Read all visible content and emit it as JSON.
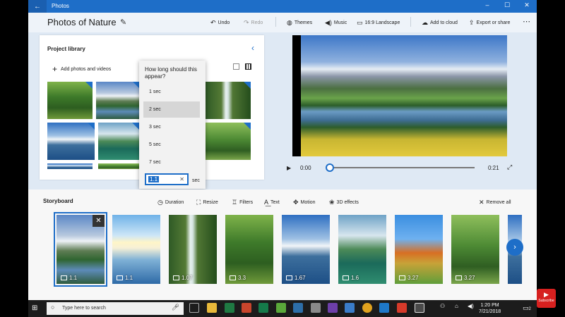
{
  "window": {
    "app_name": "Photos",
    "back_icon": "←",
    "minimize": "–",
    "maximize": "☐",
    "close": "✕"
  },
  "header": {
    "project_title": "Photos of Nature",
    "undo": "Undo",
    "redo": "Redo",
    "themes": "Themes",
    "music": "Music",
    "aspect": "16:9 Landscape",
    "add_to_cloud": "Add to cloud",
    "export": "Export or share",
    "more": "⋯"
  },
  "library": {
    "title": "Project library",
    "add_photos": "Add photos and videos"
  },
  "duration_popup": {
    "question": "How long should this appear?",
    "options": [
      "1 sec",
      "2 sec",
      "3 sec",
      "5 sec",
      "7 sec"
    ],
    "selected_index": 1,
    "custom_value": "1.1",
    "unit": "sec"
  },
  "preview": {
    "current_time": "0:00",
    "total_time": "0:21"
  },
  "storyboard": {
    "title": "Storyboard",
    "tools": {
      "duration": "Duration",
      "resize": "Resize",
      "filters": "Filters",
      "text": "Text",
      "motion": "Motion",
      "effects": "3D effects",
      "remove_all": "Remove all"
    },
    "cards": [
      {
        "duration": "1.1"
      },
      {
        "duration": "1.1"
      },
      {
        "duration": "1.07"
      },
      {
        "duration": "3.3"
      },
      {
        "duration": "1.67"
      },
      {
        "duration": "1.6"
      },
      {
        "duration": "3.27"
      },
      {
        "duration": "3.27"
      }
    ]
  },
  "taskbar": {
    "search_placeholder": "Type here to search",
    "time": "1:20 PM",
    "date": "7/21/2018",
    "notifications": "2"
  },
  "overlay": {
    "subscribe": "Subscribe"
  }
}
